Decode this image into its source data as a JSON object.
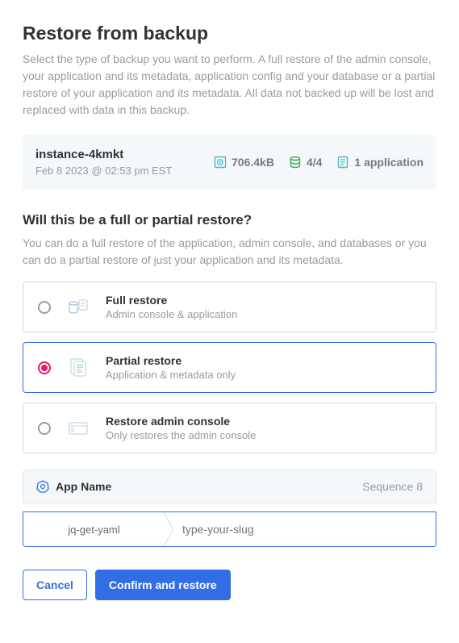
{
  "header": {
    "title": "Restore from backup",
    "description": "Select the type of backup you want to perform. A full restore of the admin console, your application and its metadata, application config and your database or a partial restore of your application and its metadata. All data not backed up will be lost and replaced with data in this backup."
  },
  "backup": {
    "name": "instance-4kmkt",
    "timestamp": "Feb 8 2023 @ 02:53 pm EST",
    "size": "706.4kB",
    "volumes": "4/4",
    "applications": "1 application"
  },
  "restore_section": {
    "title": "Will this be a full or partial restore?",
    "description": "You can do a full restore of the application, admin console, and databases or you can do a partial restore of just your application and its metadata."
  },
  "options": {
    "full": {
      "title": "Full restore",
      "subtitle": "Admin console & application"
    },
    "partial": {
      "title": "Partial restore",
      "subtitle": "Application & metadata only"
    },
    "admin": {
      "title": "Restore admin console",
      "subtitle": "Only restores the admin console"
    }
  },
  "app": {
    "name_label": "App Name",
    "sequence": "Sequence 8",
    "slug_label": "jq-get-yaml",
    "slug_placeholder": "type-your-slug"
  },
  "actions": {
    "cancel": "Cancel",
    "confirm": "Confirm and restore"
  }
}
